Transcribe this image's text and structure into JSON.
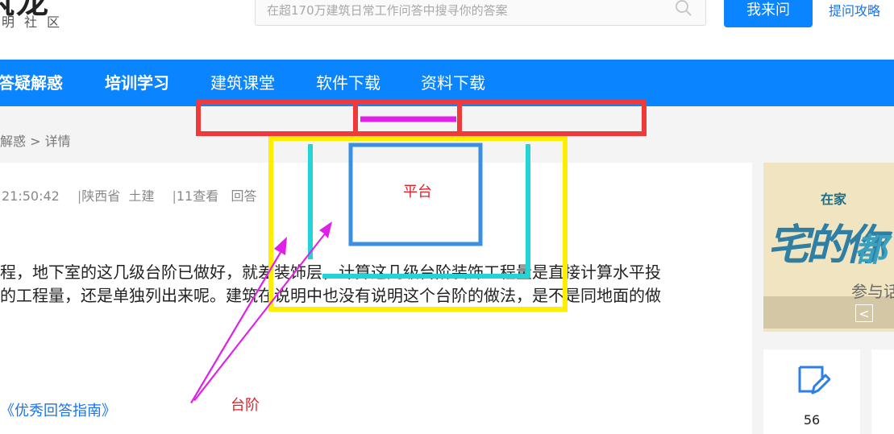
{
  "header": {
    "logo_sub": "明社区",
    "search_placeholder": "在超170万建筑日常工作问答中搜寻你的答案",
    "ask_button": "我来问",
    "guide_link": "提问攻略"
  },
  "nav": {
    "items": [
      {
        "label": "答疑解惑"
      },
      {
        "label": "培训学习"
      },
      {
        "label": "建筑课堂"
      },
      {
        "label": "软件下载"
      },
      {
        "label": "资料下载"
      }
    ]
  },
  "breadcrumb": "解惑 > 详情",
  "question": {
    "time": "21:50:42",
    "separator": "|",
    "region": "陕西省",
    "category": "土建",
    "views": "11查看",
    "answer_link": "回答",
    "line1": "程，地下室的这几级台阶已做好，就差装饰层，计算这几级台阶装饰工程量是直接计算水平投",
    "line2": "的工程量，还是单独列出来呢。建筑在说明中也没有说明这个台阶的做法，是不是同地面的做",
    "guide": "《优秀回答指南》"
  },
  "sidebar": {
    "banner_small": "在家",
    "banner_big": "宅的你",
    "banner_big2": "都",
    "banner_sub": "参与话",
    "banner_prev": "<",
    "stat_value": "56"
  },
  "annotations": {
    "platform_label": "平台",
    "step_label": "台阶"
  },
  "colors": {
    "brand_blue": "#0a84ff",
    "annot_red": "#e0202a",
    "annot_yellow": "#ffee00",
    "annot_cyan": "#22d3d8",
    "annot_blue": "#3a8fe0",
    "annot_magenta": "#e020e8"
  }
}
